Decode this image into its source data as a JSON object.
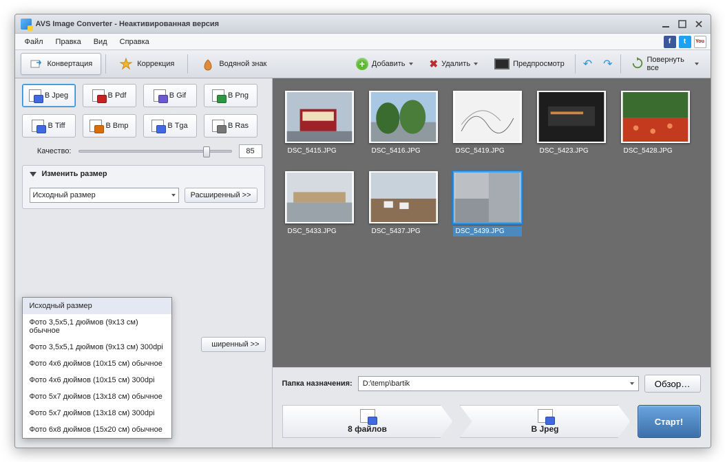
{
  "title": "AVS Image Converter - Неактивированная версия",
  "menu": {
    "file": "Файл",
    "edit": "Правка",
    "view": "Вид",
    "help": "Справка"
  },
  "social": {
    "fb": "f",
    "tw": "t",
    "yt": "You"
  },
  "tabs": {
    "convert": "Конвертация",
    "correct": "Коррекция",
    "watermark": "Водяной знак"
  },
  "toolbar": {
    "add": "Добавить",
    "del": "Удалить",
    "preview": "Предпросмотр",
    "rotate_all": "Повернуть все"
  },
  "formats": {
    "jpeg": "В Jpeg",
    "pdf": "В Pdf",
    "gif": "В Gif",
    "png": "В Png",
    "tiff": "В Tiff",
    "bmp": "В Bmp",
    "tga": "В Tga",
    "ras": "В Ras"
  },
  "quality": {
    "label": "Качество:",
    "value": "85",
    "pct": 85
  },
  "resize": {
    "header": "Изменить размер",
    "combo_value": "Исходный размер",
    "advanced": "Расширенный >>",
    "options": [
      "Исходный размер",
      "Фото 3,5x5,1 дюймов (9x13 см) обычное",
      "Фото 3,5x5,1 дюймов (9x13 см) 300dpi",
      "Фото 4x6 дюймов (10x15 см) обычное",
      "Фото 4x6 дюймов (10x15 см) 300dpi",
      "Фото 5x7 дюймов (13x18 см) обычное",
      "Фото 5x7 дюймов (13x18 см) 300dpi",
      "Фото 6x8 дюймов (15x20 см) обычное"
    ]
  },
  "rename": {
    "peek_adv": "ширенный >>"
  },
  "thumbs": {
    "selected_index": 7,
    "items": [
      {
        "name": "DSC_5415.JPG",
        "kind": "tram"
      },
      {
        "name": "DSC_5416.JPG",
        "kind": "trees"
      },
      {
        "name": "DSC_5419.JPG",
        "kind": "sketch"
      },
      {
        "name": "DSC_5423.JPG",
        "kind": "dark"
      },
      {
        "name": "DSC_5428.JPG",
        "kind": "garden"
      },
      {
        "name": "DSC_5433.JPG",
        "kind": "street"
      },
      {
        "name": "DSC_5437.JPG",
        "kind": "harbor"
      },
      {
        "name": "DSC_5439.JPG",
        "kind": "gray"
      }
    ]
  },
  "dest": {
    "label": "Папка назначения:",
    "path": "D:\\temp\\bartik",
    "browse": "Обзор…"
  },
  "status": {
    "files": "8 файлов",
    "fmt": "В Jpeg",
    "start": "Старт!"
  }
}
